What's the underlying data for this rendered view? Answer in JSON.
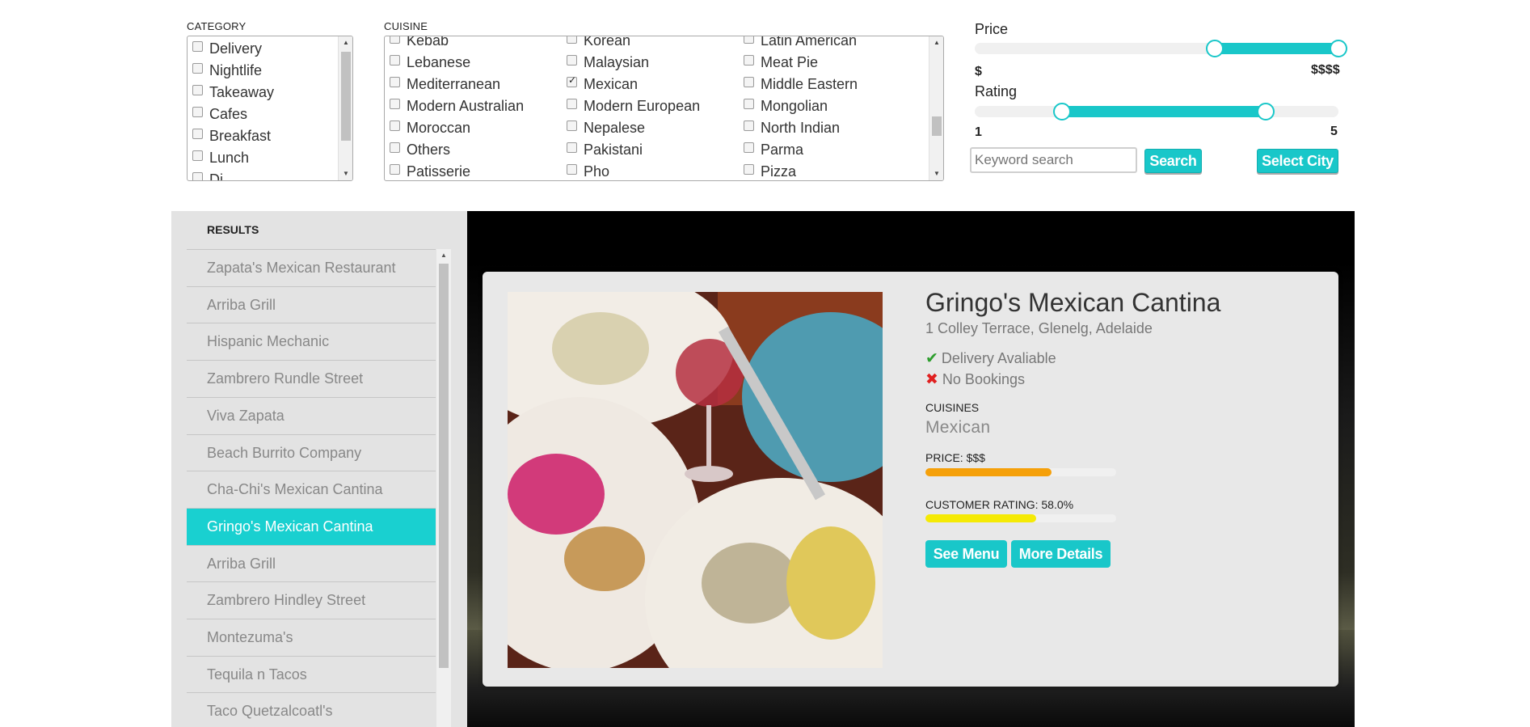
{
  "filters": {
    "category": {
      "label": "CATEGORY",
      "options": [
        {
          "label": "Delivery",
          "checked": false
        },
        {
          "label": "Nightlife",
          "checked": false
        },
        {
          "label": "Takeaway",
          "checked": false
        },
        {
          "label": "Cafes",
          "checked": false
        },
        {
          "label": "Breakfast",
          "checked": false
        },
        {
          "label": "Lunch",
          "checked": false
        },
        {
          "label": "Di",
          "checked": false
        }
      ]
    },
    "cuisine": {
      "label": "CUISINE",
      "options": [
        {
          "label": "Kebab",
          "checked": false
        },
        {
          "label": "Korean",
          "checked": false
        },
        {
          "label": "Latin American",
          "checked": false
        },
        {
          "label": "Lebanese",
          "checked": false
        },
        {
          "label": "Malaysian",
          "checked": false
        },
        {
          "label": "Meat Pie",
          "checked": false
        },
        {
          "label": "Mediterranean",
          "checked": false
        },
        {
          "label": "Mexican",
          "checked": true
        },
        {
          "label": "Middle Eastern",
          "checked": false
        },
        {
          "label": "Modern Australian",
          "checked": false
        },
        {
          "label": "Modern European",
          "checked": false
        },
        {
          "label": "Mongolian",
          "checked": false
        },
        {
          "label": "Moroccan",
          "checked": false
        },
        {
          "label": "Nepalese",
          "checked": false
        },
        {
          "label": "North Indian",
          "checked": false
        },
        {
          "label": "Others",
          "checked": false
        },
        {
          "label": "Pakistani",
          "checked": false
        },
        {
          "label": "Parma",
          "checked": false
        },
        {
          "label": "Patisserie",
          "checked": false
        },
        {
          "label": "Pho",
          "checked": false
        },
        {
          "label": "Pizza",
          "checked": false
        }
      ]
    },
    "price": {
      "label": "Price",
      "min_label": "$",
      "max_label": "$$$$",
      "range_fraction": [
        0.66,
        1.0
      ]
    },
    "rating": {
      "label": "Rating",
      "min_label": "1",
      "max_label": "5",
      "range_fraction": [
        0.24,
        0.8
      ]
    },
    "keyword_placeholder": "Keyword search",
    "search_label": "Search",
    "select_city_label": "Select City"
  },
  "results": {
    "title": "RESULTS",
    "active": "Gringo's Mexican Cantina",
    "items": [
      "Zapata's Mexican Restaurant",
      "Arriba Grill",
      "Hispanic Mechanic",
      "Zambrero Rundle Street",
      "Viva Zapata",
      "Beach Burrito Company",
      "Cha-Chi's Mexican Cantina",
      "Gringo's Mexican Cantina",
      "Arriba Grill",
      "Zambrero Hindley Street",
      "Montezuma's",
      "Tequila n Tacos",
      "Taco Quetzalcoatl's"
    ]
  },
  "detail": {
    "name": "Gringo's Mexican Cantina",
    "address": "1 Colley Terrace, Glenelg, Adelaide",
    "delivery": "Delivery Avaliable",
    "bookings": "No Bookings",
    "cuisines_label": "CUISINES",
    "cuisines_value": "Mexican",
    "price_label": "PRICE: $$$",
    "price_fraction": 0.66,
    "rating_label": "CUSTOMER RATING: 58.0%",
    "rating_fraction": 0.58,
    "see_menu_label": "See Menu",
    "more_details_label": "More Details",
    "colors": {
      "accent": "#19c7c9",
      "price_bar": "#f5a00a",
      "rating_bar": "#f5ea05",
      "check": "#2e9e2e",
      "cross": "#e02020"
    },
    "icons": [
      "check-icon",
      "cross-icon"
    ]
  }
}
